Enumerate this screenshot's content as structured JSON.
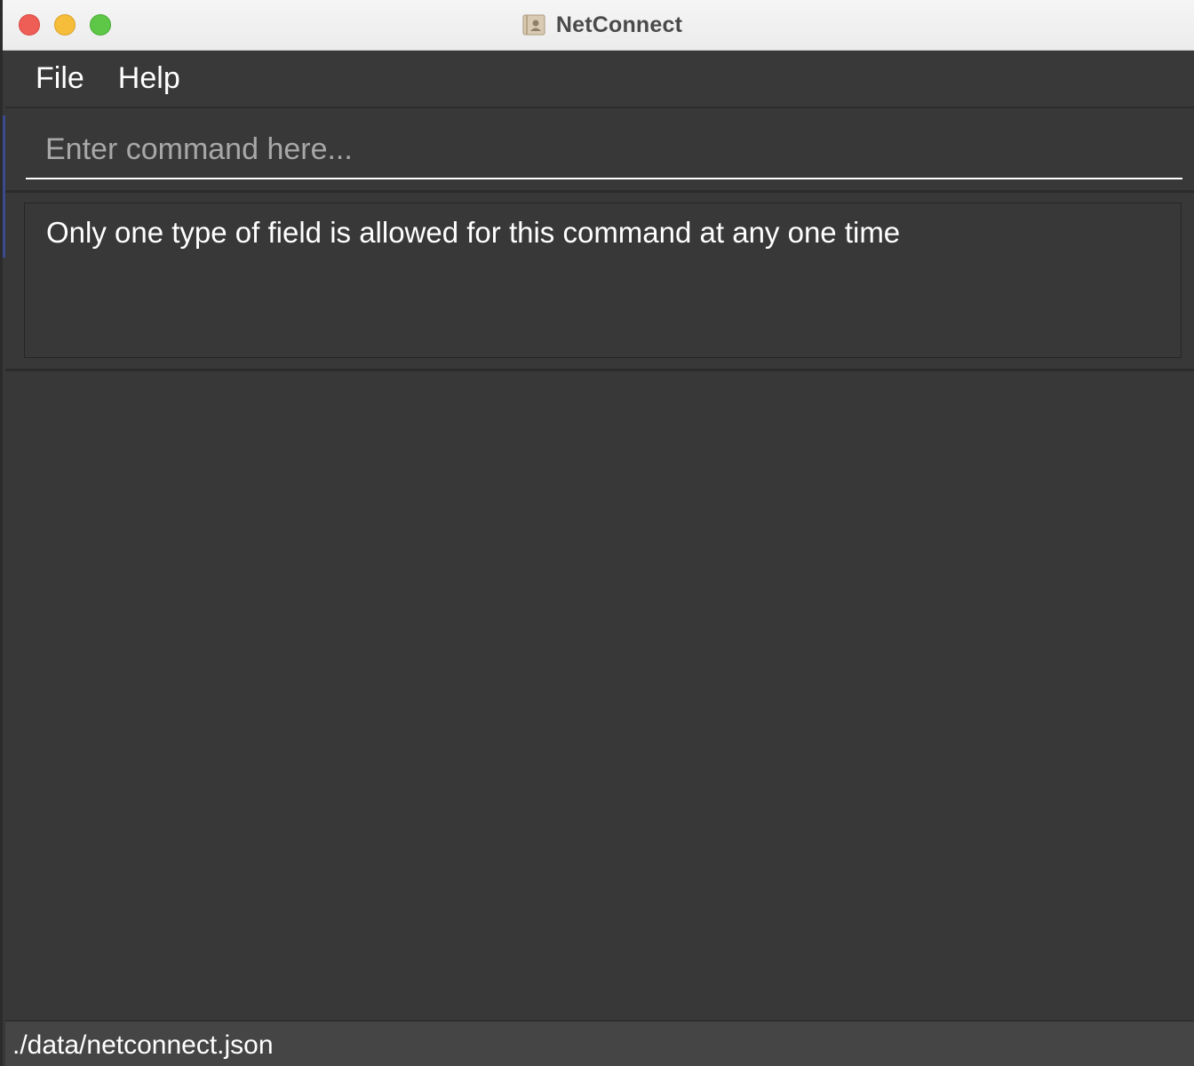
{
  "window": {
    "title": "NetConnect"
  },
  "menu": {
    "items": [
      {
        "label": "File"
      },
      {
        "label": "Help"
      }
    ]
  },
  "command": {
    "value": "",
    "placeholder": "Enter command here..."
  },
  "result": {
    "message": "Only one type of field is allowed for this command at any one time"
  },
  "status": {
    "file_path": "./data/netconnect.json"
  },
  "colors": {
    "background": "#383838",
    "text": "#ffffff",
    "placeholder": "#a8a8a8",
    "close": "#ee5e56",
    "minimize": "#f5bd3a",
    "zoom": "#5ec748"
  }
}
